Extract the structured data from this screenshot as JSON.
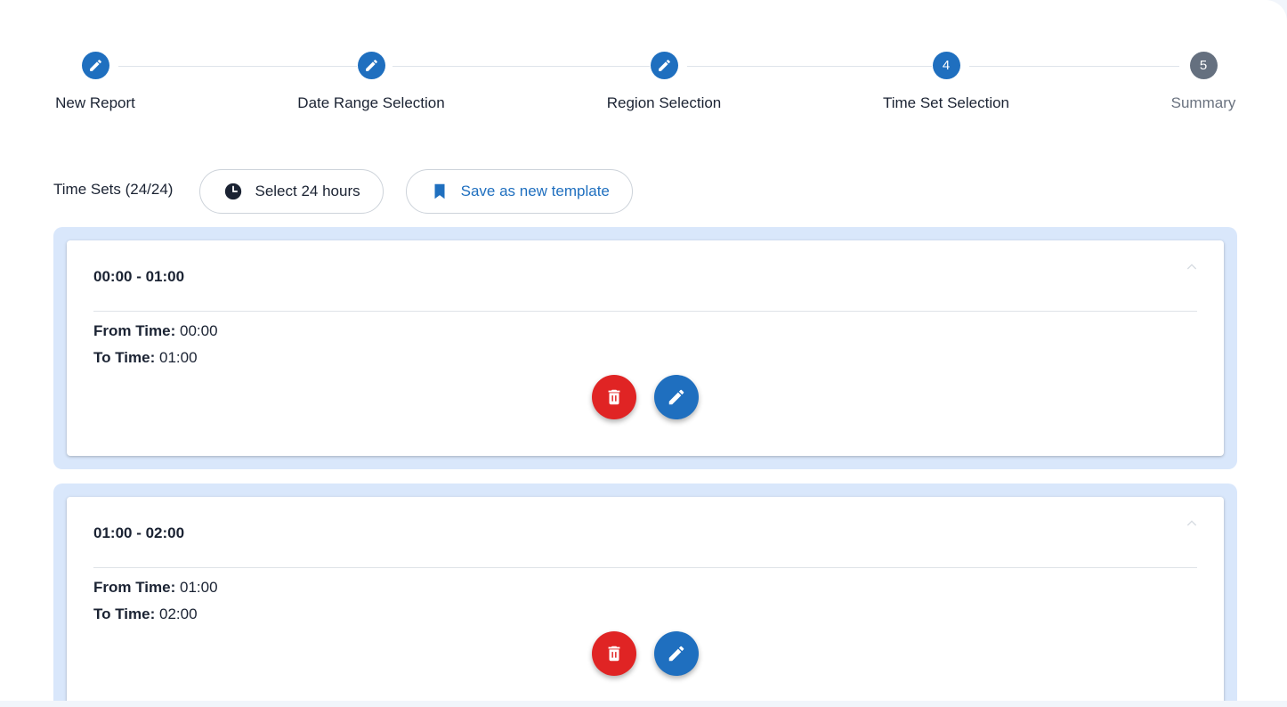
{
  "stepper": {
    "steps": [
      {
        "label": "New Report",
        "state": "completed",
        "icon": "pencil-icon"
      },
      {
        "label": "Date Range Selection",
        "state": "completed",
        "icon": "pencil-icon"
      },
      {
        "label": "Region Selection",
        "state": "completed",
        "icon": "pencil-icon"
      },
      {
        "label": "Time Set Selection",
        "state": "active",
        "number": "4"
      },
      {
        "label": "Summary",
        "state": "pending",
        "number": "5"
      }
    ]
  },
  "toolbar": {
    "title": "Time Sets (24/24)",
    "select_hours_label": "Select 24 hours",
    "select_hours_icon": "clock-icon",
    "save_template_label": "Save as new template",
    "save_template_icon": "bookmark-icon"
  },
  "time_sets": [
    {
      "title": "00:00 - 01:00",
      "from_label": "From Time:",
      "from_value": "00:00",
      "to_label": "To Time:",
      "to_value": "01:00"
    },
    {
      "title": "01:00 - 02:00",
      "from_label": "From Time:",
      "from_value": "01:00",
      "to_label": "To Time:",
      "to_value": "02:00"
    }
  ],
  "colors": {
    "primary": "#1f6fbf",
    "danger": "#e02424",
    "pending": "#65707f",
    "card_wrap": "#d9e7fb"
  }
}
